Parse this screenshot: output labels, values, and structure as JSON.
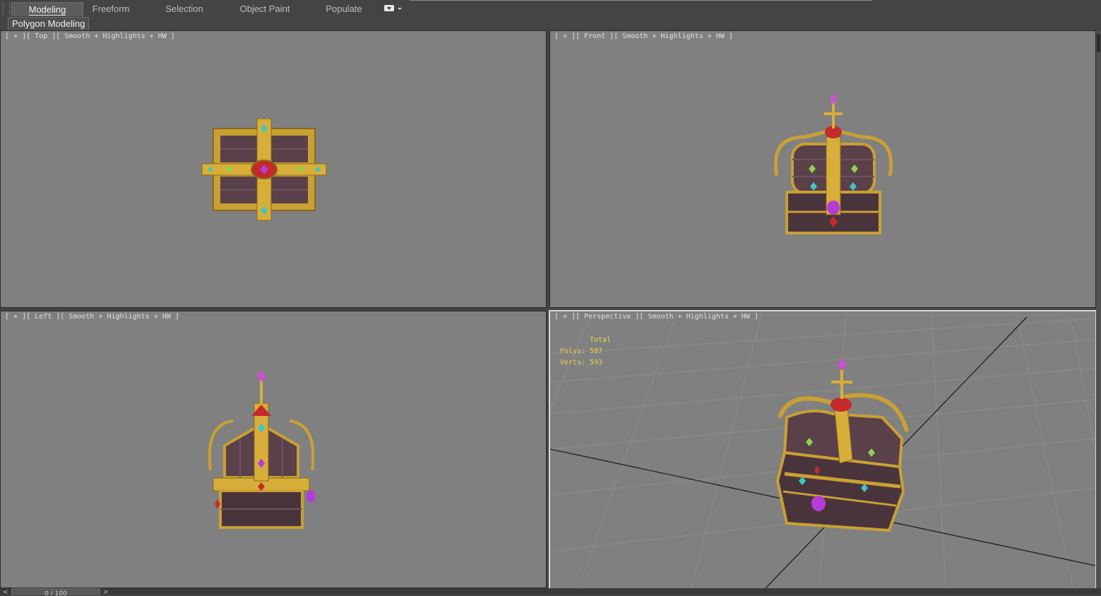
{
  "ribbon": {
    "tabs": [
      {
        "label": "Modeling",
        "active": true
      },
      {
        "label": "Freeform",
        "active": false
      },
      {
        "label": "Selection",
        "active": false
      },
      {
        "label": "Object Paint",
        "active": false
      },
      {
        "label": "Populate",
        "active": false
      }
    ],
    "options_icon": "ribbon-options-icon"
  },
  "subbar": {
    "panel_label": "Polygon Modeling"
  },
  "viewports": {
    "top": {
      "label": "[ + ][ Top ][ Smooth + Highlights + HW ]"
    },
    "front": {
      "label": "[ + ][ Front ][ Smooth + Highlights + HW ]"
    },
    "left": {
      "label": "[ + ][ Left ][ Smooth + Highlights + HW ]"
    },
    "perspective": {
      "label": "[ + ][ Perspective ][ Smooth + Highlights + HW ]",
      "stats": {
        "header": "Total",
        "polys": "Polys: 587",
        "verts": "Verts: 593"
      }
    }
  },
  "model": {
    "name_icon": "crown-treasure-chest",
    "gold": "#c9a033",
    "wood": "#5a4049",
    "gem_red": "#c42a2a",
    "gem_purple": "#b53cd8",
    "gem_teal": "#3fc6c0"
  },
  "timeline": {
    "frame": "0 / 100",
    "prev": "<",
    "next": ">"
  },
  "colors": {
    "viewport_bg": "#808080",
    "ui_bg": "#444444",
    "stats_text": "#e8d24a"
  }
}
